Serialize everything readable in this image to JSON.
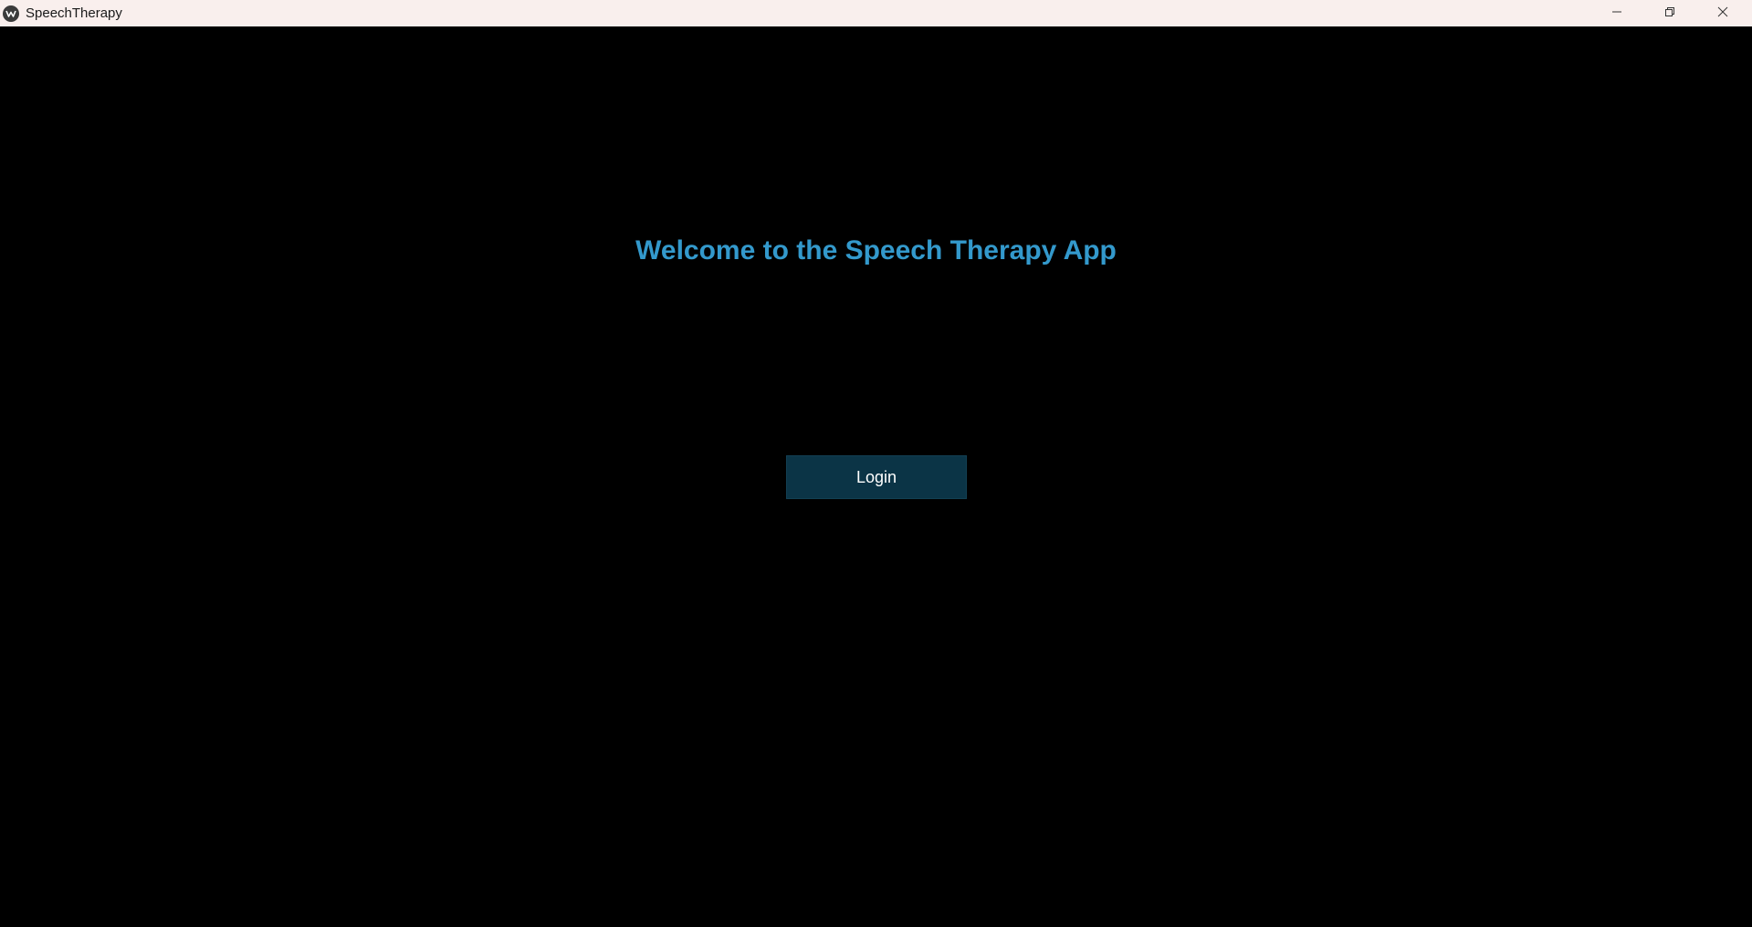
{
  "window": {
    "title": "SpeechTherapy",
    "icon": "kivy-app-icon",
    "controls": {
      "minimize_icon": "minimize-icon",
      "restore_icon": "restore-icon",
      "close_icon": "close-icon"
    }
  },
  "main": {
    "welcome_text": "Welcome to the Speech Therapy App",
    "login_label": "Login"
  },
  "colors": {
    "titlebar_bg": "#f9efed",
    "background": "#000000",
    "heading": "#3399cc",
    "button_bg": "#0b3446",
    "button_text": "#ffffff"
  }
}
